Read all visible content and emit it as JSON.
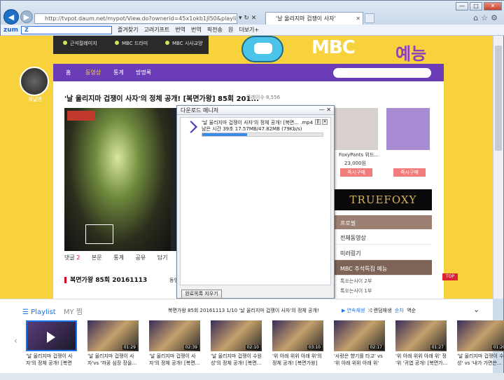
{
  "browser": {
    "address": "http://tvpot.daum.net/mypot/View.do?ownerid=45x1okb1Jl50&playlistid=6866396",
    "address_domain": "daum.net",
    "tab_title": "'날 울리지마 겁쟁이 사자'",
    "toolbar": {
      "logo": "zum",
      "search_value": "Z",
      "items": [
        "즐겨찾기",
        "고려기프트",
        "번역",
        "번역",
        "픽전송",
        "원",
        "더보기+"
      ]
    }
  },
  "site": {
    "banner_items": [
      "근석절례미지",
      "MBC 드라미",
      "MBC 시사교양"
    ],
    "brand_text": "MBC",
    "brand_sub": "예능",
    "channel_label": "채널명",
    "nav": [
      "홈",
      "동영상",
      "통계",
      "방명록"
    ]
  },
  "video": {
    "title": "'날 울리지마 겁쟁이 사자'의 정체 공개! [복면가왕] 85회 201...",
    "views": "플레이수 8,556",
    "tabs": [
      {
        "label": "댓글",
        "n": "2"
      },
      {
        "label": "본문"
      },
      {
        "label": "통계"
      },
      {
        "label": "공유"
      },
      {
        "label": "담기"
      }
    ],
    "section_title": "복면가왕 85회 20161113",
    "section_more": "동영상 10"
  },
  "ad": {
    "product": "FoxyPants 위드...",
    "price": "23,000원",
    "buy_label": "즉시구매",
    "brand": "TRUEFOXY"
  },
  "sidebar": {
    "header": "프로필",
    "items": [
      "전체동영상",
      "미러링기",
      "MBC 추석특집 예능"
    ],
    "subitems": [
      "톡쏘는사이 2부",
      "톡쏘는사이 1부"
    ],
    "top": "TOP"
  },
  "download": {
    "title": "다운로드 매니저",
    "file": "'날 울리지마 겁쟁이 사자'의 정체 공개! [복면... .mp4",
    "status": "남은 시간 39초 17.57MB/47.82MB (79Kb/s)",
    "progress": 0.37,
    "clear_label": "완료목록 지우기"
  },
  "playlist": {
    "tab_playlist": "Playlist",
    "tab_my": "MY 찜",
    "now_playing": "복면가왕 85회 20161113 1/10 '날 울리지마 겁쟁이 사자'의 정체 공개!",
    "controls": [
      "연속재생",
      "랜덤재생",
      "순차",
      "역순"
    ],
    "items": [
      {
        "caption": "'날 울리지마 겁쟁이 사자'의 정체 공개! [복면가...",
        "duration": ""
      },
      {
        "caption": "'날 울리지마 겁쟁이 사 자'vs '까꿍 심장 장을...",
        "duration": "01:29"
      },
      {
        "caption": "'날 울리지마 겁쟁이 사 자'의 정체 공개! [복면...",
        "duration": "02:39"
      },
      {
        "caption": "'날 울리지마 겁쟁이 수원 성'의 정체 공개! [복면...",
        "duration": "02:10"
      },
      {
        "caption": "'위 아래 위위 아래 위'의 정체 공개! [복면가왕]",
        "duration": "03:10"
      },
      {
        "caption": "'사랑은 향기를 타고' vs '위 아래 위위 아래 위'",
        "duration": "02:17"
      },
      {
        "caption": "'위 아래 위위 아래 위' 정 '위 '귀엽 공개! [복면가...",
        "duration": "01:27"
      },
      {
        "caption": "'날 울리지마 겁쟁이 수원 성' vs '내가 가면쓴...",
        "duration": "01:20"
      }
    ]
  },
  "colors": {
    "page_bg": "#f7d23c",
    "nav_bg": "#6a3db7",
    "accent": "#1a73e8"
  }
}
